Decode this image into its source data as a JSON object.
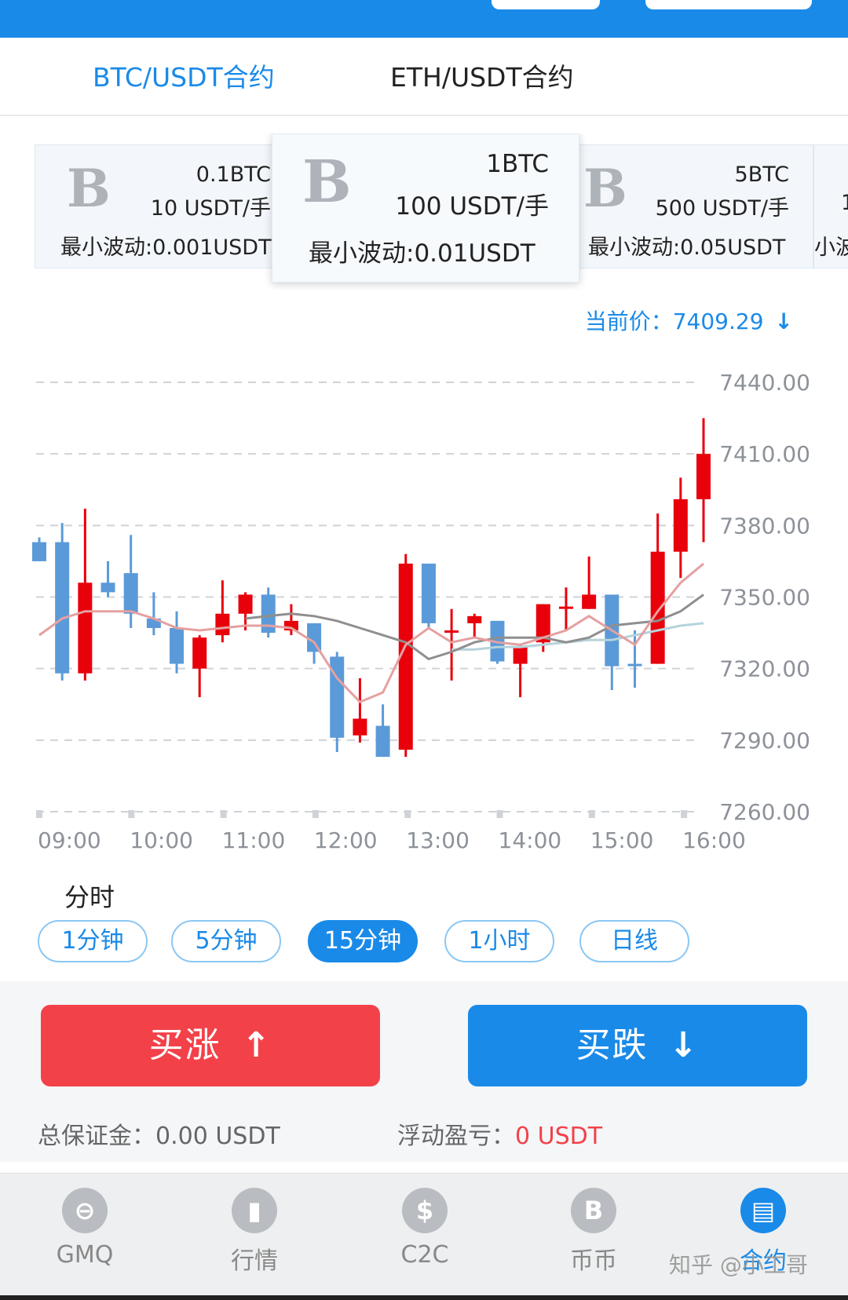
{
  "tabs": [
    {
      "label": "BTC/USDT合约",
      "active": true
    },
    {
      "label": "ETH/USDT合约",
      "active": false
    }
  ],
  "contracts": [
    {
      "logo": "B",
      "size": "0.1BTC",
      "price": "10 USDT/手",
      "tick": "最小波动:0.001USDT"
    },
    {
      "logo": "B",
      "size": "1BTC",
      "price": "100 USDT/手",
      "tick": "最小波动:0.01USDT",
      "selected": true
    },
    {
      "logo": "B",
      "size": "5BTC",
      "price": "500 USDT/手",
      "tick": "最小波动:0.05USDT"
    },
    {
      "logo": "",
      "size": "1",
      "price": "",
      "tick": "小波"
    }
  ],
  "current_price": {
    "label": "当前价：",
    "value": "7409.29",
    "direction": "down"
  },
  "chart_data": {
    "type": "candlestick",
    "x_ticks": [
      "09:00",
      "10:00",
      "11:00",
      "12:00",
      "13:00",
      "14:00",
      "15:00",
      "16:00"
    ],
    "y_ticks": [
      "7440.00",
      "7410.00",
      "7380.00",
      "7350.00",
      "7320.00",
      "7290.00",
      "7260.00"
    ],
    "ylim": [
      7260,
      7440
    ],
    "colors": {
      "up": "#e8000b",
      "down": "#5b9ad8",
      "ma_red": "#e5a0a0",
      "ma_gray": "#8f8f8f",
      "ma_teal": "#b6d3db"
    },
    "candles": [
      {
        "o": 7373,
        "h": 7375,
        "l": 7365,
        "c": 7365
      },
      {
        "o": 7373,
        "h": 7381,
        "l": 7315,
        "c": 7318
      },
      {
        "o": 7318,
        "h": 7387,
        "l": 7315,
        "c": 7356
      },
      {
        "o": 7356,
        "h": 7365,
        "l": 7350,
        "c": 7352
      },
      {
        "o": 7360,
        "h": 7376,
        "l": 7337,
        "c": 7343
      },
      {
        "o": 7341,
        "h": 7352,
        "l": 7334,
        "c": 7337
      },
      {
        "o": 7337,
        "h": 7344,
        "l": 7318,
        "c": 7322
      },
      {
        "o": 7320,
        "h": 7334,
        "l": 7308,
        "c": 7333
      },
      {
        "o": 7334,
        "h": 7357,
        "l": 7331,
        "c": 7343
      },
      {
        "o": 7343,
        "h": 7352,
        "l": 7336,
        "c": 7351
      },
      {
        "o": 7351,
        "h": 7354,
        "l": 7333,
        "c": 7335
      },
      {
        "o": 7336,
        "h": 7347,
        "l": 7334,
        "c": 7340
      },
      {
        "o": 7339,
        "h": 7339,
        "l": 7322,
        "c": 7327
      },
      {
        "o": 7325,
        "h": 7327,
        "l": 7285,
        "c": 7291
      },
      {
        "o": 7292,
        "h": 7316,
        "l": 7289,
        "c": 7299
      },
      {
        "o": 7296,
        "h": 7305,
        "l": 7283,
        "c": 7283
      },
      {
        "o": 7286,
        "h": 7368,
        "l": 7283,
        "c": 7364
      },
      {
        "o": 7364,
        "h": 7364,
        "l": 7337,
        "c": 7339
      },
      {
        "o": 7336,
        "h": 7345,
        "l": 7315,
        "c": 7336
      },
      {
        "o": 7339,
        "h": 7343,
        "l": 7333,
        "c": 7342
      },
      {
        "o": 7340,
        "h": 7340,
        "l": 7322,
        "c": 7323
      },
      {
        "o": 7322,
        "h": 7330,
        "l": 7308,
        "c": 7329
      },
      {
        "o": 7331,
        "h": 7347,
        "l": 7327,
        "c": 7347
      },
      {
        "o": 7346,
        "h": 7354,
        "l": 7336,
        "c": 7346
      },
      {
        "o": 7345,
        "h": 7367,
        "l": 7345,
        "c": 7351
      },
      {
        "o": 7351,
        "h": 7351,
        "l": 7311,
        "c": 7321
      },
      {
        "o": 7322,
        "h": 7336,
        "l": 7312,
        "c": 7321
      },
      {
        "o": 7322,
        "h": 7385,
        "l": 7322,
        "c": 7369
      },
      {
        "o": 7369,
        "h": 7400,
        "l": 7358,
        "c": 7391
      },
      {
        "o": 7391,
        "h": 7425,
        "l": 7373,
        "c": 7410
      }
    ],
    "ma_red": [
      7334,
      7341,
      7344,
      7344,
      7344,
      7341,
      7337,
      7336,
      7337,
      7338,
      7338,
      7337,
      7331,
      7316,
      7306,
      7310,
      7330,
      7337,
      7331,
      7333,
      7331,
      7330,
      7333,
      7336,
      7342,
      7336,
      7330,
      7344,
      7356,
      7364
    ],
    "ma_gray": [
      7341,
      7342,
      7343,
      7342,
      7340,
      7337,
      7334,
      7331,
      7324,
      7327,
      7331,
      7333,
      7333,
      7333,
      7331,
      7333,
      7338,
      7339,
      7340,
      7344,
      7351
    ],
    "ma_teal": [
      7328,
      7328,
      7329,
      7329,
      7330,
      7331,
      7332,
      7332,
      7334,
      7336,
      7338,
      7339
    ]
  },
  "period_title": "分时",
  "periods": [
    {
      "label": "1分钟",
      "active": false
    },
    {
      "label": "5分钟",
      "active": false
    },
    {
      "label": "15分钟",
      "active": true
    },
    {
      "label": "1小时",
      "active": false
    },
    {
      "label": "日线",
      "active": false
    }
  ],
  "trade": {
    "buy_up": "买涨",
    "buy_down": "买跌",
    "margin_label": "总保证金：",
    "margin_value": "0.00 USDT",
    "pnl_label": "浮动盈亏：",
    "pnl_value": "0 USDT"
  },
  "nav": [
    {
      "label": "GMQ",
      "icon": "gmq-icon",
      "glyph": "⊖"
    },
    {
      "label": "行情",
      "icon": "market-chart-icon",
      "glyph": "▮"
    },
    {
      "label": "C2C",
      "icon": "dollar-icon",
      "glyph": "$"
    },
    {
      "label": "币币",
      "icon": "coin-b-icon",
      "glyph": "B"
    },
    {
      "label": "合约",
      "icon": "contract-icon",
      "glyph": "▤",
      "active": true
    }
  ],
  "watermark": "知乎 @小工哥"
}
